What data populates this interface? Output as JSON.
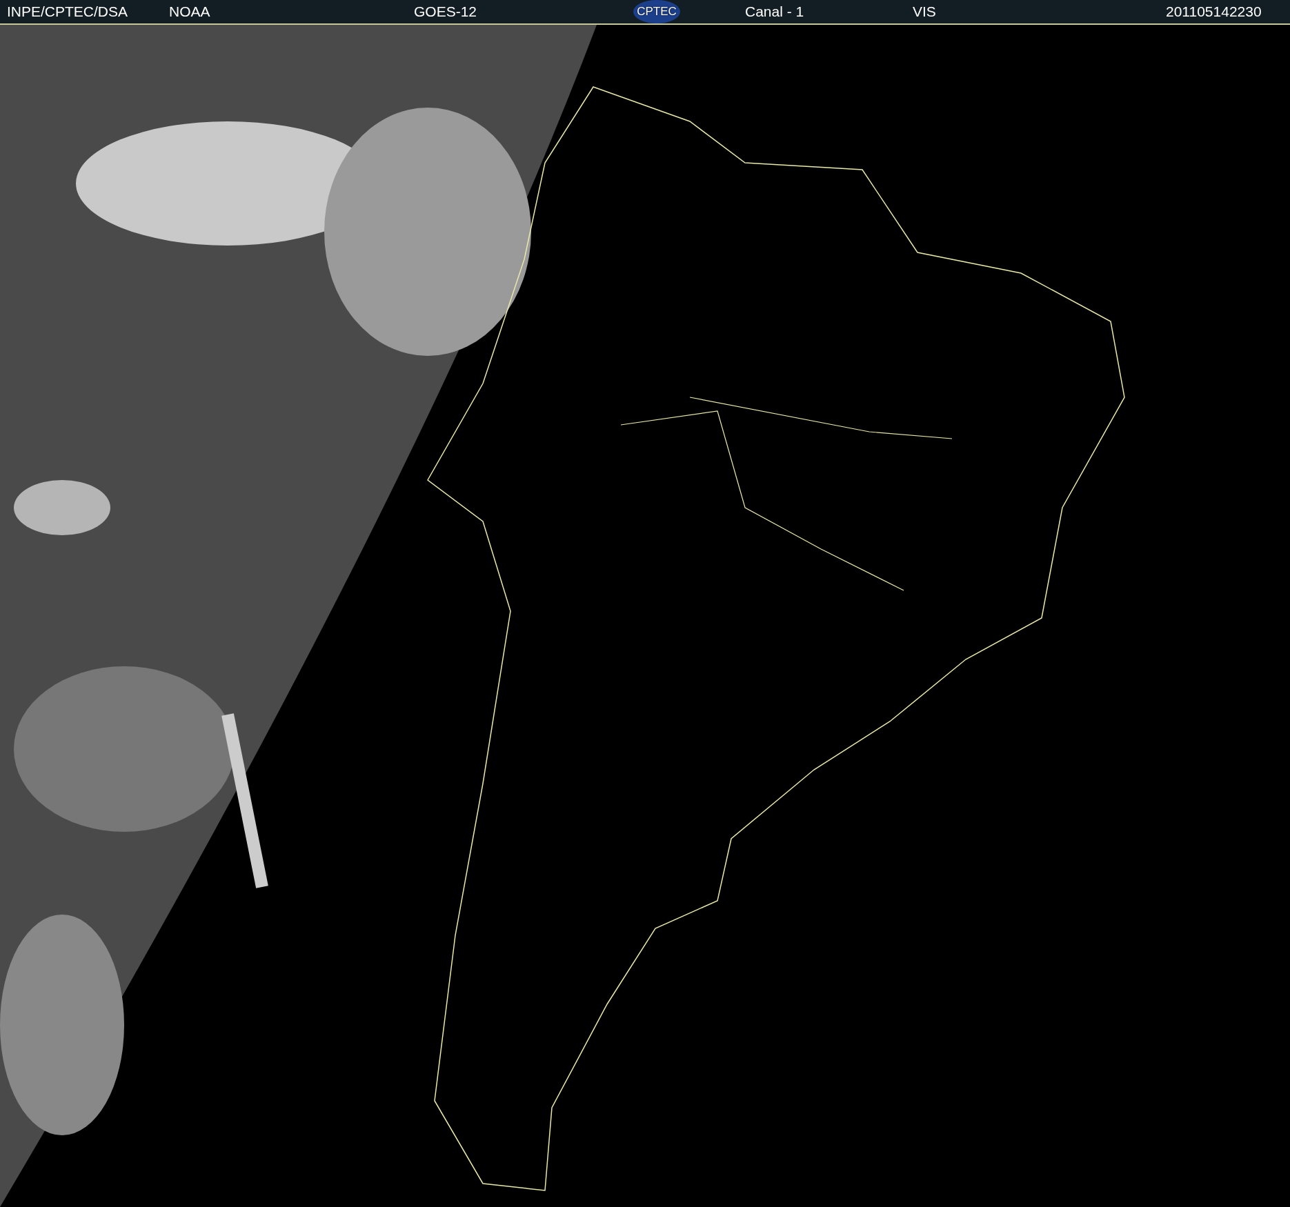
{
  "header": {
    "agency": "INPE/CPTEC/DSA",
    "source": "NOAA",
    "satellite": "GOES-12",
    "logo": "CPTEC",
    "channel": "Canal - 1",
    "band": "VIS",
    "timestamp": "201105142230"
  }
}
